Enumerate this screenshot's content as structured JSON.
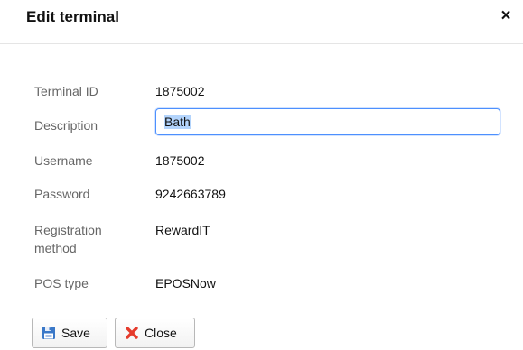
{
  "dialog": {
    "title": "Edit terminal",
    "close_glyph": "×"
  },
  "fields": {
    "terminal_id": {
      "label": "Terminal ID",
      "value": "1875002"
    },
    "description": {
      "label": "Description",
      "value": "Bath"
    },
    "username": {
      "label": "Username",
      "value": "1875002"
    },
    "password": {
      "label": "Password",
      "value": "9242663789"
    },
    "registration_method": {
      "label": "Registration method",
      "value": "RewardIT"
    },
    "pos_type": {
      "label": "POS type",
      "value": "EPOSNow"
    }
  },
  "buttons": {
    "save_label": "Save",
    "close_label": "Close",
    "save_icon": "floppy-disk-icon",
    "close_icon": "red-x-icon"
  },
  "colors": {
    "input_focus_border": "#4d90fe",
    "close_icon_red": "#e53b2c",
    "save_icon_blue": "#3a78c8"
  }
}
